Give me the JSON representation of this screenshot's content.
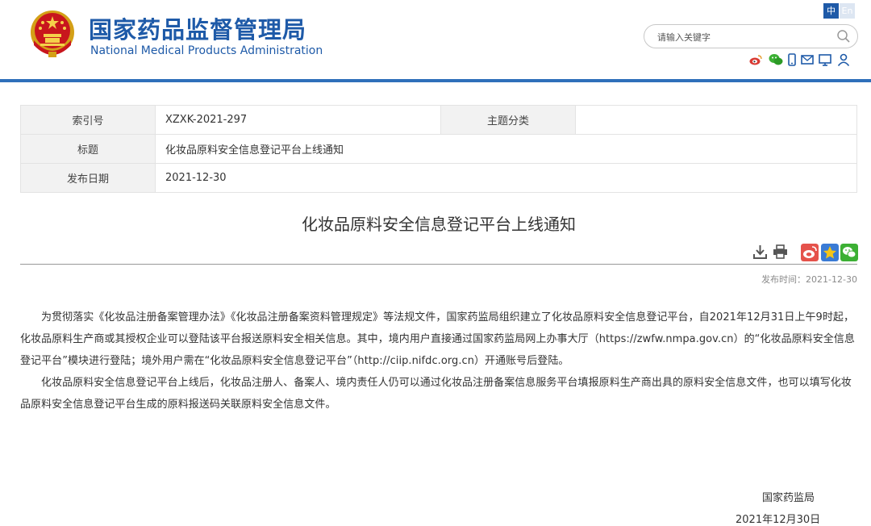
{
  "header": {
    "site_name_cn": "国家药品监督管理局",
    "site_name_en": "National Medical Products Administration",
    "lang_zh": "中",
    "lang_en": "En",
    "search_placeholder": "请输入关键字",
    "social_icons": [
      "weibo-icon",
      "wechat-icon",
      "mobile-icon",
      "mail-icon",
      "comment-icon",
      "user-icon"
    ]
  },
  "info": {
    "index_label": "索引号",
    "index_value": "XZXK-2021-297",
    "category_label": "主题分类",
    "category_value": "",
    "title_label": "标题",
    "title_value": "化妆品原料安全信息登记平台上线通知",
    "date_label": "发布日期",
    "date_value": "2021-12-30"
  },
  "article": {
    "title": "化妆品原料安全信息登记平台上线通知",
    "publish_time": "发布时间：2021-12-30",
    "paragraphs": [
      "为贯彻落实《化妆品注册备案管理办法》《化妆品注册备案资料管理规定》等法规文件，国家药监局组织建立了化妆品原料安全信息登记平台，自2021年12月31日上午9时起，化妆品原料生产商或其授权企业可以登陆该平台报送原料安全相关信息。其中，境内用户直接通过国家药监局网上办事大厅（https://zwfw.nmpa.gov.cn）的“化妆品原料安全信息登记平台”模块进行登陆；境外用户需在“化妆品原料安全信息登记平台”（http://ciip.nifdc.org.cn）开通账号后登陆。",
      "化妆品原料安全信息登记平台上线后，化妆品注册人、备案人、境内责任人仍可以通过化妆品注册备案信息服务平台填报原料生产商出具的原料安全信息文件，也可以填写化妆品原料安全信息登记平台生成的原料报送码关联原料安全信息文件。"
    ],
    "signature_org": "国家药监局",
    "signature_date": "2021年12月30日"
  },
  "colors": {
    "brand_blue": "#1e5aa8",
    "bar_blue": "#2f6fba",
    "weibo_red": "#e5524b",
    "star_blue": "#3a7bd5",
    "wechat_green": "#3cb034"
  }
}
